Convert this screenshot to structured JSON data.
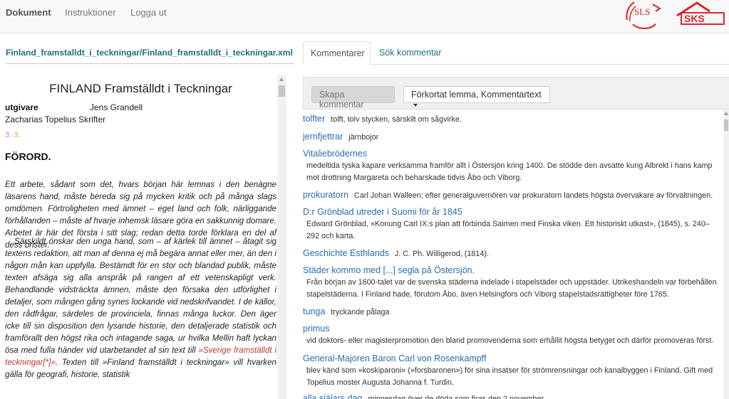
{
  "nav": {
    "items": [
      {
        "label": "Dokument"
      },
      {
        "label": "Instruktioner"
      },
      {
        "label": "Logga ut"
      }
    ],
    "logo_sls": "SLS",
    "logo_sks": "SKS",
    "brand_red": "#d9262b"
  },
  "left": {
    "path": "Finland_framstalldt_i_teckningar/Finland_framstalldt_i_teckningar.xml",
    "title": "FINLAND Framställdt i Teckningar",
    "editor_label": "utgivare",
    "editor_name": "Jens Grandell",
    "series": "Zacharias Topelius Skrifter",
    "page_ref_1": "3.",
    "page_ref_2": "3.",
    "section": "FÖRORD.",
    "para1": "Ett arbete, sådant som det, hvars början här lemnas i den benägne läsarens hand, måste bereda sig på mycken kritik och på många slags omdömen. Förtroligheten med ämnet – eget land och folk, närliggande förhållanden – måste af hvarje inhemsk läsare göra en sakkunnig domare. Arbetet är här det första i sitt slag; redan detta torde förklara en del af dess brister.",
    "para2_a": "Särskildt önskar den unga hand, som – af kärlek till ämnet – åtagit sig textens redaktion, att man af denna ej må begära annat eller mer, än den i någon mån kan uppfylla. Bestämdt för en stor och blandad publik, måste texten afsäga sig alla anspråk på rangen af ett vetenskapligt verk. Behandlande vidsträckta ämnen, måste den försaka den utförlighet i detaljer, som mången gång synes lockande vid nedskrifvandet. I de källor, den rådfrågar, särdeles de provinciela, finnas många luckor. Den äger icke till sin disposition den lysande historie, den detaljerade statistik och framförallt den högst rika och intagande saga, ur hvilka Mellin haft lyckan ösa med fulla händer vid utarbetandet af sin text till ",
    "para2_link": "»Sverige framställdt i teckningar[*]»",
    "para2_b": ". Texten till »Finland framställdt i teckningar» vill hvarken gälla för geografi, historie, statistik"
  },
  "tabs": [
    {
      "label": "Kommentarer"
    },
    {
      "label": "Sök kommentar"
    }
  ],
  "toolbar": {
    "create_label": "Skapa kommentar",
    "view_label": "Förkortat lemma, Kommentartext"
  },
  "comments": [
    {
      "lemma": "tolfter",
      "text": "tolft, tolv stycken, särskilt om sågvirke.",
      "inline": true
    },
    {
      "lemma": "jernfjettrar",
      "text": "järnbojor",
      "inline": true
    },
    {
      "lemma": "Vitaliebrödernes",
      "text": "medeltida tyska kapare verksamma framför allt i Östersjön kring 1400. De stödde den avsatte kung Albrekt i hans kamp mot drottning Margareta och beharskade tidvis Åbo och Viborg.",
      "inline": false
    },
    {
      "lemma": "prokuratorn",
      "text": "Carl Johan Walleen; efter generalguvernören var prokuratorn landets högsta övervakare av förvaltningen.",
      "inline": true
    },
    {
      "lemma": "D:r Grönblad utreder i Suomi för år 1845",
      "text": "Edward Grönblad, »Konung Carl IX:s plan att förbinda Saimen med Finska viken. Ett historiskt utkast», (1845), s. 240–292 och karta.",
      "inline": false
    },
    {
      "lemma": "Geschichte Esthlands",
      "text": "J. C. Ph. Willigerod, (1814).",
      "inline": true
    },
    {
      "lemma": "Städer kommo med [...] segla på Östersjön.",
      "text": "Från början av 1600-talet var de svenska städerna indelade i stapelstäder och uppstäder. Utrikeshandeln var förbehållen stapelstäderna. I Finland hade, förutom Åbo, även Helsingfors och Viborg stapelstadsrättigheter före 1765.",
      "inline": false
    },
    {
      "lemma": "tunga",
      "text": "tryckande pålaga",
      "inline": true
    },
    {
      "lemma": "primus",
      "text": "vid doktors- eller magisterpromotion den bland promovenderna som erhållit högsta betyget och därför promoveras först.",
      "inline": false
    },
    {
      "lemma": "General-Majoren Baron Carl von Rosenkampff",
      "text": "blev känd som »koskiparoni» (»forsbaronen») för sina insatser för strömrensningar och kanalbyggen i Finland. Gift med Topelius moster Augusta Johanna f. Turdin.",
      "inline": false
    },
    {
      "lemma": "alla själars dag",
      "text": "minnesdag över de döda som firas den 2 november.",
      "inline": true
    }
  ]
}
